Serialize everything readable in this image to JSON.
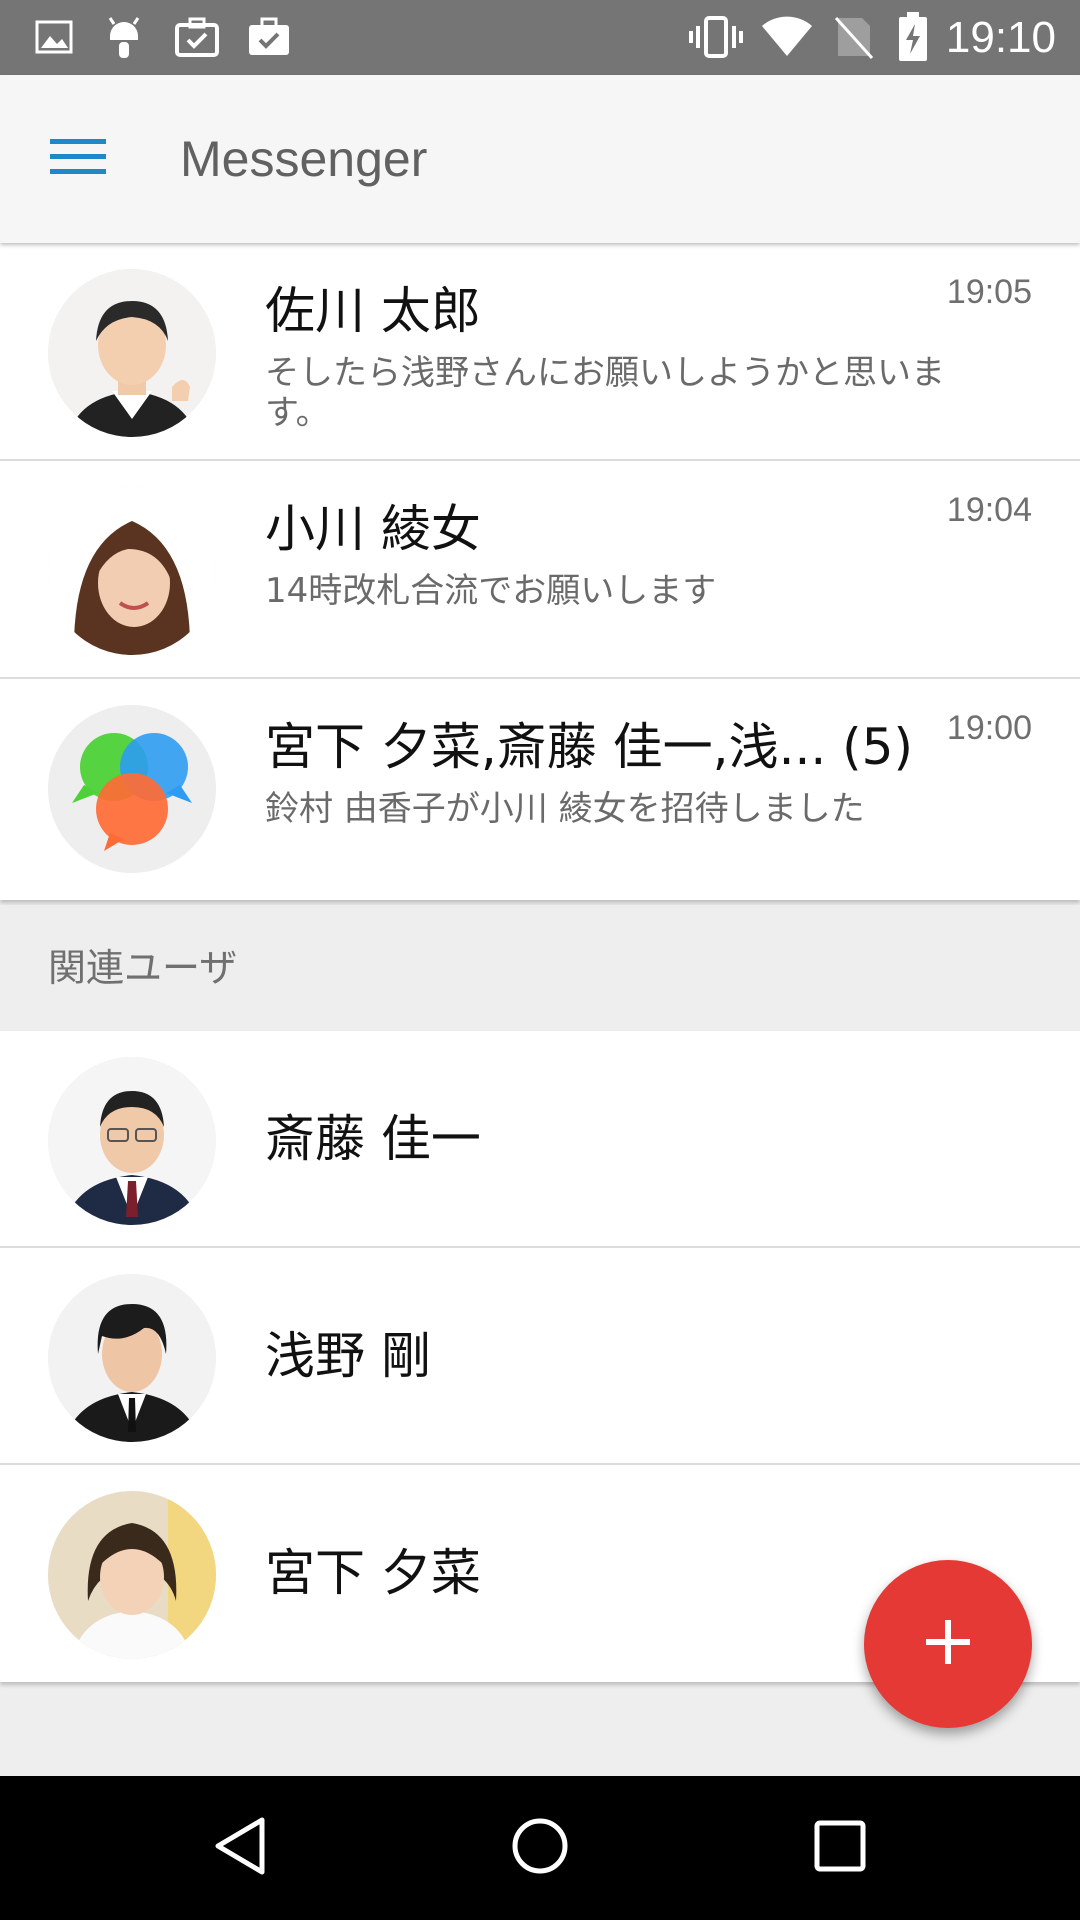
{
  "status_bar": {
    "time": "19:10",
    "left_icons": [
      "image-icon",
      "android-icon",
      "briefcase-check-icon",
      "briefcase-check-icon"
    ],
    "right_icons": [
      "vibrate-icon",
      "wifi-icon",
      "no-sim-icon",
      "battery-charging-icon"
    ]
  },
  "app_bar": {
    "title": "Messenger",
    "menu_icon": "menu-icon",
    "accent_color": "#1e88c8"
  },
  "conversations": [
    {
      "name": "佐川 太郎",
      "time": "19:05",
      "preview": "そしたら浅野さんにお願いしようかと思います。",
      "avatar": "person-photo"
    },
    {
      "name": "小川 綾女",
      "time": "19:04",
      "preview": "14時改札合流でお願いします",
      "avatar": "person-photo"
    },
    {
      "name": "宮下 夕菜,斎藤 佳一,浅... (5)",
      "time": "19:00",
      "preview": "鈴村 由香子が小川 綾女を招待しました",
      "avatar": "group-chat-icon"
    }
  ],
  "related_section": {
    "label": "関連ユーザ"
  },
  "related_users": [
    {
      "name": "斎藤 佳一",
      "avatar": "person-photo"
    },
    {
      "name": "浅野 剛",
      "avatar": "person-photo"
    },
    {
      "name": "宮下 夕菜",
      "avatar": "person-photo"
    }
  ],
  "fab": {
    "icon": "plus-icon",
    "color": "#e53935"
  },
  "nav_bar": {
    "buttons": [
      "back-icon",
      "home-icon",
      "recents-icon"
    ]
  }
}
